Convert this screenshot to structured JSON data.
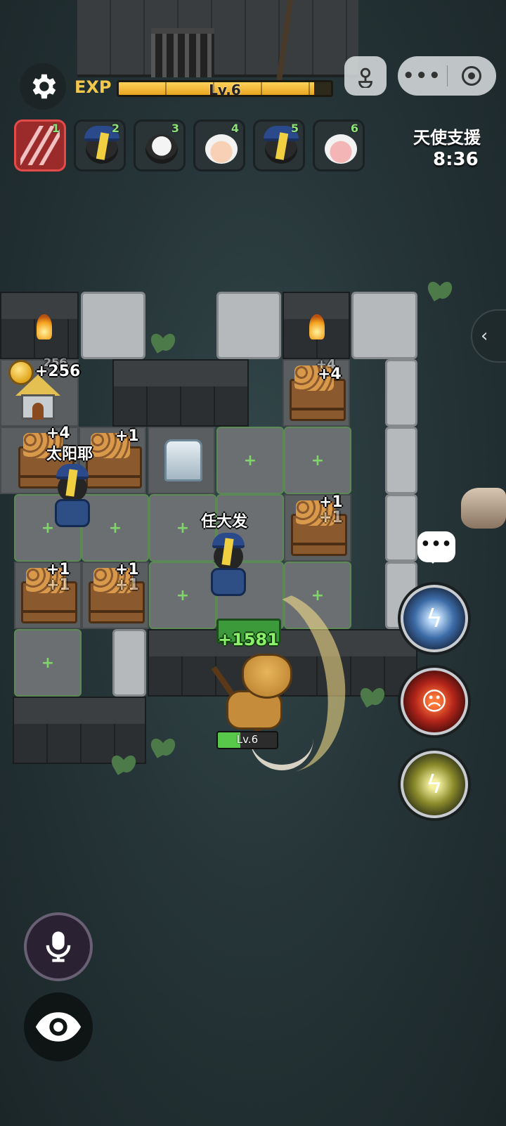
{
  "hud": {
    "exp_label": "EXP",
    "level_text": "Lv.6",
    "exp_progress": 0.92
  },
  "squad": [
    {
      "slot": "1",
      "kind": "claw-skill",
      "active": true
    },
    {
      "slot": "2",
      "kind": "jiangshi-sheep"
    },
    {
      "slot": "3",
      "kind": "black-sheep"
    },
    {
      "slot": "4",
      "kind": "white-sheep"
    },
    {
      "slot": "5",
      "kind": "jiangshi-sheep"
    },
    {
      "slot": "6",
      "kind": "pink-sheep"
    }
  ],
  "angel_support": {
    "title": "天使支援",
    "timer": "8:36"
  },
  "board": {
    "house_gain": "+256",
    "house_gain_ghost": "256",
    "crates": [
      {
        "gain": "+4",
        "ghost": "+4"
      },
      {
        "gain": "+4"
      },
      {
        "gain": "+1"
      },
      {
        "gain": "+1",
        "ghost": "+1"
      },
      {
        "gain": "+1",
        "ghost": "+1"
      },
      {
        "gain": "+1",
        "ghost": "+1"
      }
    ],
    "unit_names": [
      "太阳耶",
      "任大发"
    ]
  },
  "boss": {
    "heal": "+1581",
    "level": "Lv.6",
    "hp_fraction": 0.38
  },
  "icons": {
    "settings": "gear-icon",
    "mini_program": "mini-program-icon",
    "more": "more-dots-icon",
    "close": "target-circle-icon",
    "collapse": "chevron-left-icon",
    "chat": "chat-bubble-icon",
    "mic": "microphone-icon",
    "eye": "eye-icon"
  },
  "colors": {
    "exp_fill": "#f2b632",
    "active_slot": "#9b2b2b",
    "heal_green": "#8df06a"
  }
}
